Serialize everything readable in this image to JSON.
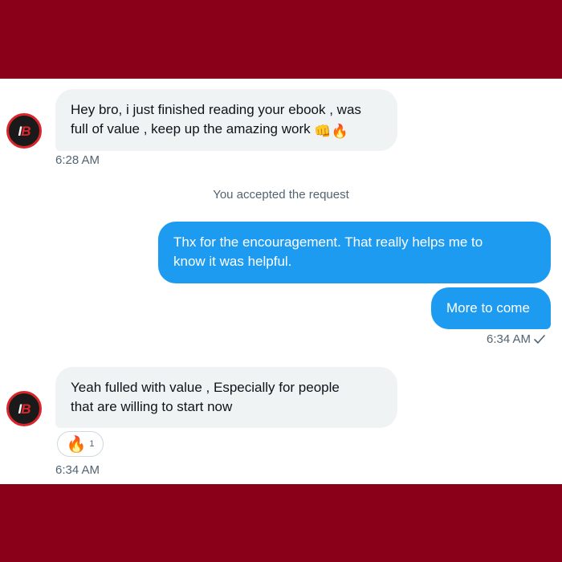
{
  "messages": {
    "m1": {
      "line1": "Hey bro, i just finished reading your ebook , was",
      "line2": "full of value , keep up the amazing work",
      "emoji1": "👊",
      "emoji2": "🔥",
      "time": "6:28 AM"
    },
    "system": "You accepted the request",
    "m2": {
      "line1": "Thx for the encouragement. That really helps me to",
      "line2": "know it was helpful."
    },
    "m3": {
      "text": "More to come",
      "time": "6:34 AM"
    },
    "m4": {
      "line1": "Yeah fulled with value , Especially for people",
      "line2": "that are willing to start now",
      "time": "6:34 AM",
      "reaction": {
        "emoji": "🔥",
        "count": "1"
      }
    }
  },
  "avatar": {
    "logo_text": "IB"
  },
  "colors": {
    "frame": "#8a0018",
    "incoming_bubble": "#eff3f4",
    "outgoing_bubble": "#1d9bf0",
    "avatar_ring": "#d8262b"
  },
  "icons": {
    "read_receipt": "check-icon"
  }
}
